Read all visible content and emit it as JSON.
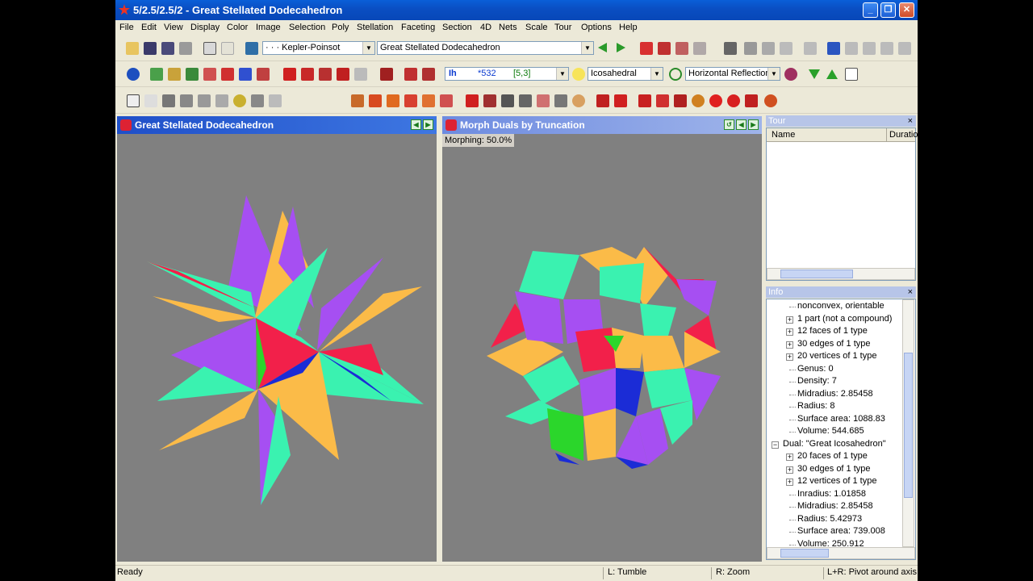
{
  "window": {
    "title": "5/2.5/2.5/2 - Great Stellated Dodecahedron"
  },
  "menu": [
    "File",
    "Edit",
    "View",
    "Display",
    "Color",
    "Image",
    "Selection",
    "Poly",
    "Stellation",
    "Faceting",
    "Section",
    "4D",
    "Nets",
    "Scale",
    "Tour",
    "Options",
    "Help"
  ],
  "toolbar": {
    "category_combo": "· · · Kepler-Poinsot",
    "poly_combo": "Great Stellated Dodecahedron",
    "symmetry_group": "Ih",
    "symmetry_order": "*532",
    "symmetry_notation": "[5,3]",
    "symmetry_combo": "Icosahedral",
    "reflection_combo": "Horizontal Reflection"
  },
  "left_panel": {
    "title": "Great Stellated Dodecahedron"
  },
  "right_panel": {
    "title": "Morph Duals by Truncation",
    "overlay": "Morphing: 50.0%"
  },
  "tour": {
    "title": "Tour",
    "columns": [
      "Name",
      "Duratio"
    ]
  },
  "info": {
    "title": "Info",
    "lines": [
      {
        "text": "nonconvex, orientable",
        "indent": 2,
        "expander": ""
      },
      {
        "text": "1 part (not a compound)",
        "indent": 2,
        "expander": "+"
      },
      {
        "text": "12 faces of 1 type",
        "indent": 2,
        "expander": "+"
      },
      {
        "text": "30 edges of 1 type",
        "indent": 2,
        "expander": "+"
      },
      {
        "text": "20 vertices of 1 type",
        "indent": 2,
        "expander": "+"
      },
      {
        "text": "Genus: 0",
        "indent": 2,
        "expander": ""
      },
      {
        "text": "Density: 7",
        "indent": 2,
        "expander": ""
      },
      {
        "text": "Midradius: 2.85458",
        "indent": 2,
        "expander": ""
      },
      {
        "text": "Radius: 8",
        "indent": 2,
        "expander": ""
      },
      {
        "text": "Surface area: 1088.83",
        "indent": 2,
        "expander": ""
      },
      {
        "text": "Volume: 544.685",
        "indent": 2,
        "expander": ""
      },
      {
        "text": "Dual: \"Great Icosahedron\"",
        "indent": 1,
        "expander": "-"
      },
      {
        "text": "20 faces of 1 type",
        "indent": 2,
        "expander": "+"
      },
      {
        "text": "30 edges of 1 type",
        "indent": 2,
        "expander": "+"
      },
      {
        "text": "12 vertices of 1 type",
        "indent": 2,
        "expander": "+"
      },
      {
        "text": "Inradius: 1.01858",
        "indent": 2,
        "expander": ""
      },
      {
        "text": "Midradius: 2.85458",
        "indent": 2,
        "expander": ""
      },
      {
        "text": "Radius: 5.42973",
        "indent": 2,
        "expander": ""
      },
      {
        "text": "Surface area: 739.008",
        "indent": 2,
        "expander": ""
      },
      {
        "text": "Volume: 250.912",
        "indent": 2,
        "expander": ""
      }
    ]
  },
  "status": {
    "left": "Ready",
    "tumble": "L: Tumble",
    "zoom": "R: Zoom",
    "pivot": "L+R: Pivot around axis"
  },
  "colors": {
    "titlebar": "#0a52c8",
    "panel_active": "#2a5bd7",
    "panel_inactive": "#7a96df",
    "viewport": "#808080",
    "violet": "#a64ff2",
    "cyan": "#3af2b0",
    "orange": "#fbbb48",
    "red": "#f2204a",
    "blue": "#1b2cd6",
    "green": "#2bd62b"
  }
}
